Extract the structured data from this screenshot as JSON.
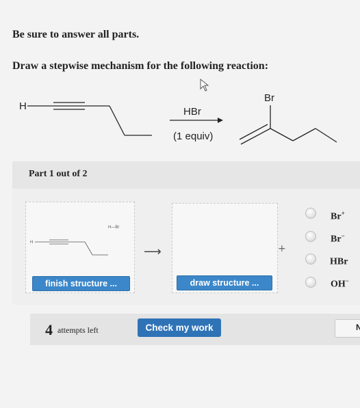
{
  "header": {
    "instruction1": "Be sure to answer all parts.",
    "instruction2": "Draw a stepwise mechanism for the following reaction:"
  },
  "reaction": {
    "reactant_h": "H",
    "reagent": "HBr",
    "equiv": "(1 equiv)",
    "product_br": "Br"
  },
  "part": {
    "label": "Part 1 out of 2"
  },
  "canvas1": {
    "mini_hbr": "H—Br",
    "mini_h": "H",
    "finish_label": "finish structure ..."
  },
  "canvas2": {
    "draw_label": "draw structure ..."
  },
  "arrow_symbol": "⟶",
  "plus_symbol": "+",
  "options": [
    {
      "label": "Br",
      "sup": "+"
    },
    {
      "label": "Br",
      "sup": "−"
    },
    {
      "label": "HBr",
      "sup": ""
    },
    {
      "label": "OH",
      "sup": "−"
    }
  ],
  "footer": {
    "attempts_count": "4",
    "attempts_text": "attempts left",
    "check_label": "Check my work",
    "next_label": "N"
  },
  "colors": {
    "button_blue": "#3b87c9",
    "check_blue": "#2f73b7"
  }
}
